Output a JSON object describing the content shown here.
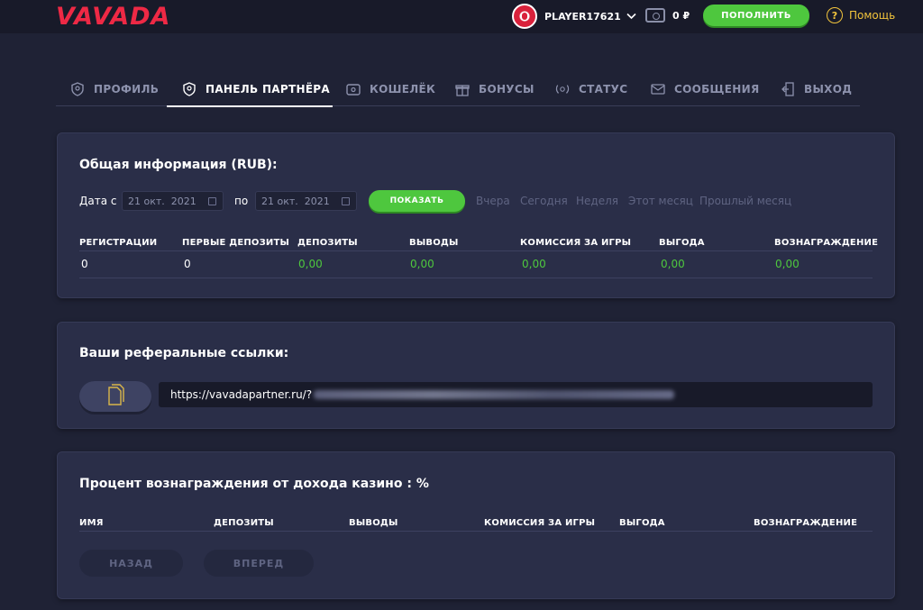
{
  "header": {
    "logo": "VAVADA",
    "username": "PLAYER17621",
    "balance": "0 ₽",
    "topup_label": "ПОПОЛНИТЬ",
    "help_label": "Помощь"
  },
  "tabs": [
    {
      "label": "ПРОФИЛЬ",
      "icon": "shield-icon",
      "active": false
    },
    {
      "label": "ПАНЕЛЬ ПАРТНЁРА",
      "icon": "shield-icon",
      "active": true
    },
    {
      "label": "КОШЕЛЁК",
      "icon": "wallet-icon",
      "active": false
    },
    {
      "label": "БОНУСЫ",
      "icon": "gift-icon",
      "active": false
    },
    {
      "label": "СТАТУС",
      "icon": "laurel-icon",
      "active": false
    },
    {
      "label": "СООБЩЕНИЯ",
      "icon": "envelope-icon",
      "active": false
    },
    {
      "label": "ВЫХОД",
      "icon": "exit-icon",
      "active": false
    }
  ],
  "general": {
    "title": "Общая информация (RUB):",
    "date_from_label": "Дата с",
    "date_from": "21 окт.  2021",
    "date_to_label": "по",
    "date_to": "21 окт.  2021",
    "show_label": "ПОКАЗАТЬ",
    "quick_ranges": [
      "Вчера",
      "Сегодня",
      "Неделя",
      "Этот месяц",
      "Прошлый месяц"
    ],
    "columns": [
      "РЕГИСТРАЦИИ",
      "ПЕРВЫЕ ДЕПОЗИТЫ",
      "ДЕПОЗИТЫ",
      "ВЫВОДЫ",
      "КОМИССИЯ ЗА ИГРЫ",
      "ВЫГОДА",
      "ВОЗНАГРАЖДЕНИЕ"
    ],
    "values": [
      "0",
      "0",
      "0,00",
      "0,00",
      "0,00",
      "0,00",
      "0,00"
    ]
  },
  "referral": {
    "title": "Ваши реферальные ссылки:",
    "link_prefix": "https://vavadapartner.ru/?"
  },
  "commission": {
    "title": "Процент вознаграждения от дохода казино : %",
    "columns": [
      "ИМЯ",
      "ДЕПОЗИТЫ",
      "ВЫВОДЫ",
      "КОМИССИЯ ЗА ИГРЫ",
      "ВЫГОДА",
      "ВОЗНАГРАЖДЕНИЕ"
    ],
    "prev_label": "НАЗАД",
    "next_label": "ВПЕРЕД"
  },
  "colors": {
    "accent_green": "#4ec73e",
    "brand_red": "#ee2945",
    "help_yellow": "#f2c43c"
  }
}
